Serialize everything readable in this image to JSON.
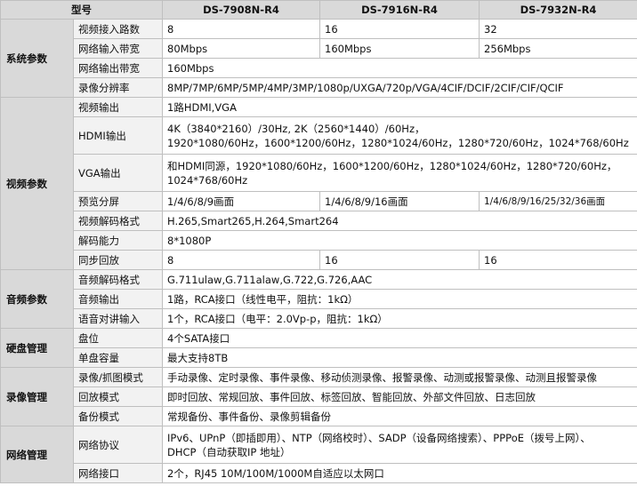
{
  "header": {
    "label": "型号",
    "models": [
      "DS-7908N-R4",
      "DS-7916N-R4",
      "DS-7932N-R4"
    ]
  },
  "sections": {
    "system": {
      "title": "系统参数",
      "rows": {
        "video_in_channels": {
          "label": "视频接入路数",
          "values": [
            "8",
            "16",
            "32"
          ]
        },
        "network_in_bandwidth": {
          "label": "网络输入带宽",
          "values": [
            "80Mbps",
            "160Mbps",
            "256Mbps"
          ]
        },
        "network_out_bandwidth": {
          "label": "网络输出带宽",
          "value": "160Mbps"
        },
        "record_resolution": {
          "label": "录像分辨率",
          "value": "8MP/7MP/6MP/5MP/4MP/3MP/1080p/UXGA/720p/VGA/4CIF/DCIF/2CIF/CIF/QCIF"
        }
      }
    },
    "video": {
      "title": "视频参数",
      "rows": {
        "video_out": {
          "label": "视频输出",
          "value": "1路HDMI,VGA"
        },
        "hdmi_out": {
          "label": "HDMI输出",
          "value_line1": "4K（3840*2160）/30Hz,   2K（2560*1440）/60Hz，",
          "value_line2": "1920*1080/60Hz，1600*1200/60Hz，1280*1024/60Hz，1280*720/60Hz，1024*768/60Hz"
        },
        "vga_out": {
          "label": "VGA输出",
          "value_line1": "和HDMI同源，1920*1080/60Hz，1600*1200/60Hz，1280*1024/60Hz，1280*720/60Hz，",
          "value_line2": "1024*768/60Hz"
        },
        "preview_split": {
          "label": "预览分屏",
          "values": [
            "1/4/6/8/9画面",
            "1/4/6/8/9/16画面",
            "1/4/6/8/9/16/25/32/36画面"
          ]
        },
        "decode_format": {
          "label": "视频解码格式",
          "value": "H.265,Smart265,H.264,Smart264"
        },
        "decode_capability": {
          "label": "解码能力",
          "value": "8*1080P"
        },
        "sync_playback": {
          "label": "同步回放",
          "values": [
            "8",
            "16",
            "16"
          ]
        }
      }
    },
    "audio": {
      "title": "音频参数",
      "rows": {
        "audio_decode": {
          "label": "音频解码格式",
          "value": "G.711ulaw,G.711alaw,G.722,G.726,AAC"
        },
        "audio_out": {
          "label": "音频输出",
          "value": "1路，RCA接口（线性电平，阻抗：1kΩ）"
        },
        "talkback_in": {
          "label": "语音对讲输入",
          "value": "1个，RCA接口（电平：2.0Vp-p，阻抗：1kΩ）"
        }
      }
    },
    "disk": {
      "title": "硬盘管理",
      "rows": {
        "bays": {
          "label": "盘位",
          "value": "4个SATA接口"
        },
        "capacity": {
          "label": "单盘容量",
          "value": "最大支持8TB"
        }
      }
    },
    "recording": {
      "title": "录像管理",
      "rows": {
        "record_mode": {
          "label": "录像/抓图模式",
          "value": "手动录像、定时录像、事件录像、移动侦测录像、报警录像、动测或报警录像、动测且报警录像"
        },
        "playback_mode": {
          "label": "回放模式",
          "value": "即时回放、常规回放、事件回放、标签回放、智能回放、外部文件回放、日志回放"
        },
        "backup_mode": {
          "label": "备份模式",
          "value": "常规备份、事件备份、录像剪辑备份"
        }
      }
    },
    "network": {
      "title": "网络管理",
      "rows": {
        "protocols": {
          "label": "网络协议",
          "value_line1": "IPv6、UPnP（即插即用）、NTP（网络校时）、SADP（设备网络搜索）、PPPoE（拨号上网）、",
          "value_line2": "DHCP（自动获取IP  地址）"
        },
        "interface": {
          "label": "网络接口",
          "value": "2个，RJ45 10M/100M/1000M自适应以太网口"
        }
      }
    }
  }
}
